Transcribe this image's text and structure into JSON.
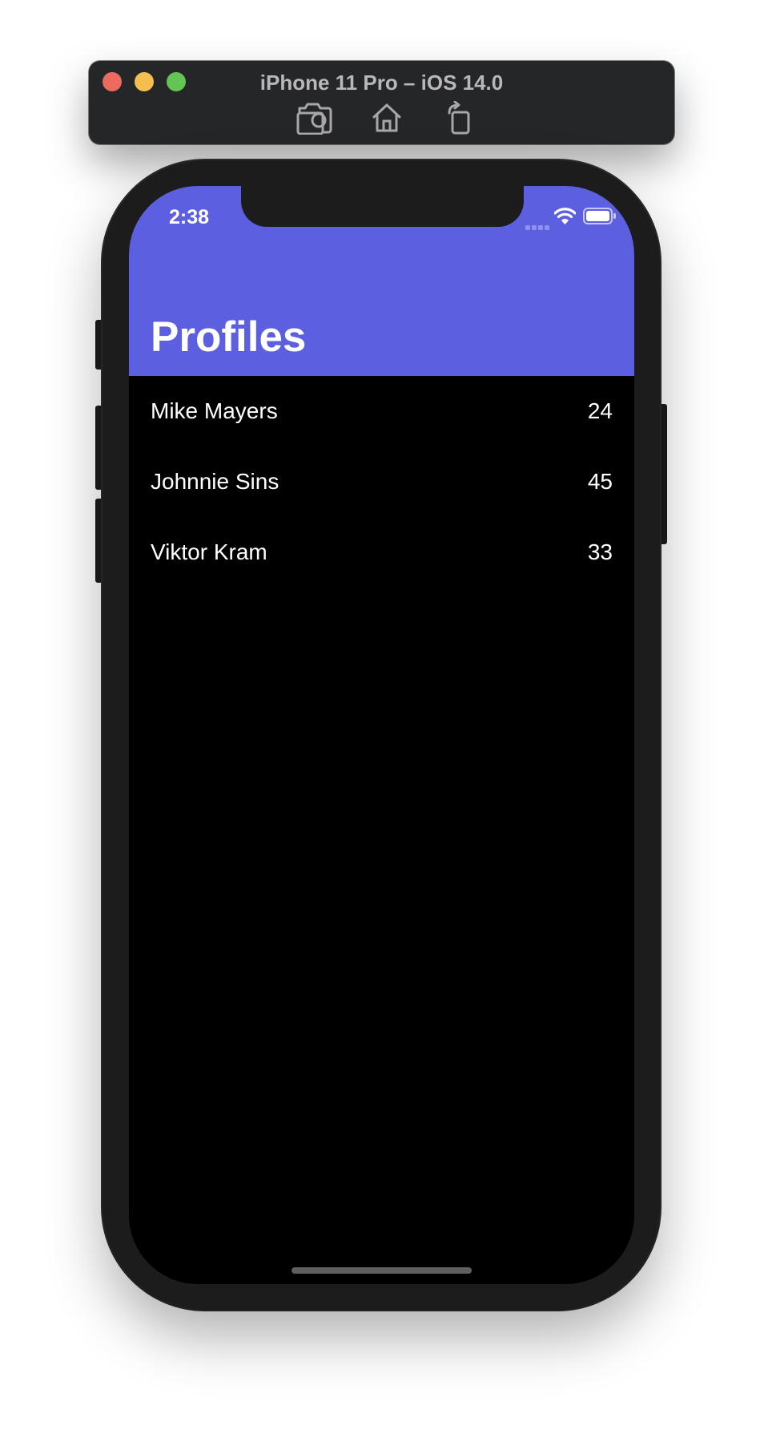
{
  "simulator": {
    "title": "iPhone 11 Pro – iOS 14.0",
    "toolbar_icons": [
      "screenshot-icon",
      "home-icon",
      "rotate-icon"
    ]
  },
  "status_bar": {
    "time": "2:38"
  },
  "navigation": {
    "title": "Profiles",
    "background_color": "#5c5fdf"
  },
  "profiles": [
    {
      "name": "Mike Mayers",
      "age": "24"
    },
    {
      "name": "Johnnie Sins",
      "age": "45"
    },
    {
      "name": "Viktor Kram",
      "age": "33"
    }
  ]
}
